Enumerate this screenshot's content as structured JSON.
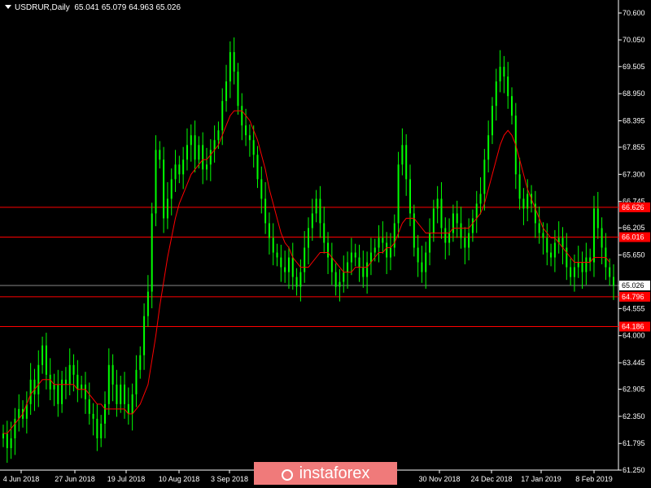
{
  "header": {
    "symbol_timeframe": "USDRUR,Daily",
    "ohlc": "65.041 65.079 64.963 65.026"
  },
  "watermark": {
    "text": "instaforex"
  },
  "colors": {
    "background": "#000000",
    "candles": "#00ff00",
    "moving_average": "#ff0000",
    "level_lines": "#ff0000",
    "price_tag": "#ffffff"
  },
  "chart_data": {
    "type": "candlestick",
    "title": "USDRUR,Daily",
    "y_axis_ticks": [
      "70.600",
      "70.050",
      "69.505",
      "68.950",
      "68.395",
      "67.855",
      "67.300",
      "66.745",
      "66.205",
      "65.650",
      "65.026",
      "64.555",
      "64.000",
      "63.445",
      "62.905",
      "62.350",
      "61.795",
      "61.250"
    ],
    "x_axis_ticks": [
      "4 Jun 2018",
      "27 Jun 2018",
      "19 Jul 2018",
      "10 Aug 2018",
      "3 Sep 2018",
      "30 Nov 2018",
      "24 Dec 2018",
      "17 Jan 2019",
      "8 Feb 2019"
    ],
    "ylim": [
      61.25,
      70.6
    ],
    "last_price": "65.026",
    "horizontal_levels": [
      "66.626",
      "66.016",
      "64.796",
      "64.186"
    ],
    "close_series": [
      62.0,
      61.7,
      61.9,
      62.3,
      62.5,
      62.3,
      62.6,
      63.1,
      62.8,
      63.4,
      63.8,
      63.2,
      62.9,
      63.0,
      62.6,
      63.1,
      63.0,
      63.4,
      63.2,
      62.9,
      63.0,
      62.7,
      62.4,
      62.3,
      61.9,
      62.2,
      62.6,
      63.4,
      63.0,
      62.6,
      63.0,
      62.6,
      62.4,
      62.8,
      63.3,
      63.6,
      64.4,
      64.9,
      66.5,
      67.8,
      67.6,
      66.4,
      66.8,
      67.2,
      67.5,
      67.3,
      67.6,
      67.9,
      68.1,
      67.6,
      67.9,
      67.4,
      67.5,
      67.8,
      68.0,
      68.2,
      68.8,
      69.2,
      69.8,
      69.4,
      68.7,
      68.3,
      68.1,
      68.0,
      67.7,
      67.2,
      66.8,
      66.3,
      66.0,
      65.7,
      65.6,
      65.4,
      65.3,
      65.6,
      65.2,
      65.0,
      65.3,
      65.8,
      66.2,
      66.5,
      66.8,
      66.3,
      65.9,
      65.6,
      65.3,
      65.0,
      65.1,
      65.3,
      65.5,
      65.7,
      65.6,
      65.4,
      65.2,
      65.5,
      65.7,
      65.8,
      66.0,
      65.9,
      65.6,
      65.8,
      66.3,
      67.5,
      67.9,
      67.2,
      66.5,
      65.8,
      65.5,
      65.3,
      65.7,
      66.1,
      66.6,
      66.8,
      66.2,
      65.9,
      66.1,
      66.5,
      66.3,
      66.0,
      65.8,
      66.1,
      66.4,
      66.7,
      66.9,
      67.6,
      68.1,
      68.7,
      69.2,
      69.5,
      69.3,
      68.9,
      68.5,
      67.3,
      66.8,
      66.6,
      66.9,
      66.7,
      66.3,
      66.1,
      66.0,
      65.7,
      65.6,
      65.9,
      66.0,
      65.8,
      65.4,
      65.2,
      65.4,
      65.5,
      65.3,
      65.6,
      65.5,
      66.6,
      66.2,
      65.8,
      65.4,
      65.2,
      65.03
    ],
    "ma_series": [
      62.0,
      62.0,
      62.1,
      62.2,
      62.3,
      62.4,
      62.6,
      62.8,
      62.9,
      63.0,
      63.1,
      63.1,
      63.1,
      63.0,
      63.0,
      63.0,
      63.0,
      63.0,
      63.0,
      62.9,
      62.9,
      62.9,
      62.8,
      62.7,
      62.6,
      62.6,
      62.5,
      62.5,
      62.5,
      62.5,
      62.5,
      62.5,
      62.4,
      62.4,
      62.5,
      62.6,
      62.8,
      63.0,
      63.5,
      64.0,
      64.6,
      65.1,
      65.6,
      66.0,
      66.4,
      66.7,
      66.9,
      67.1,
      67.3,
      67.4,
      67.5,
      67.6,
      67.6,
      67.7,
      67.8,
      67.9,
      68.1,
      68.3,
      68.5,
      68.6,
      68.6,
      68.6,
      68.5,
      68.4,
      68.2,
      68.0,
      67.7,
      67.4,
      67.0,
      66.7,
      66.4,
      66.1,
      65.9,
      65.8,
      65.6,
      65.5,
      65.4,
      65.4,
      65.4,
      65.5,
      65.6,
      65.7,
      65.7,
      65.7,
      65.6,
      65.5,
      65.4,
      65.3,
      65.3,
      65.3,
      65.4,
      65.4,
      65.4,
      65.4,
      65.5,
      65.6,
      65.7,
      65.7,
      65.8,
      65.8,
      65.9,
      66.1,
      66.3,
      66.4,
      66.4,
      66.4,
      66.3,
      66.2,
      66.1,
      66.1,
      66.1,
      66.1,
      66.1,
      66.1,
      66.1,
      66.2,
      66.2,
      66.2,
      66.2,
      66.2,
      66.3,
      66.4,
      66.5,
      66.7,
      67.0,
      67.3,
      67.6,
      67.9,
      68.1,
      68.2,
      68.1,
      67.9,
      67.6,
      67.3,
      67.0,
      66.8,
      66.6,
      66.4,
      66.2,
      66.1,
      66.0,
      66.0,
      65.9,
      65.8,
      65.7,
      65.6,
      65.5,
      65.5,
      65.5,
      65.5,
      65.5,
      65.6,
      65.6,
      65.6,
      65.6,
      65.5
    ]
  }
}
